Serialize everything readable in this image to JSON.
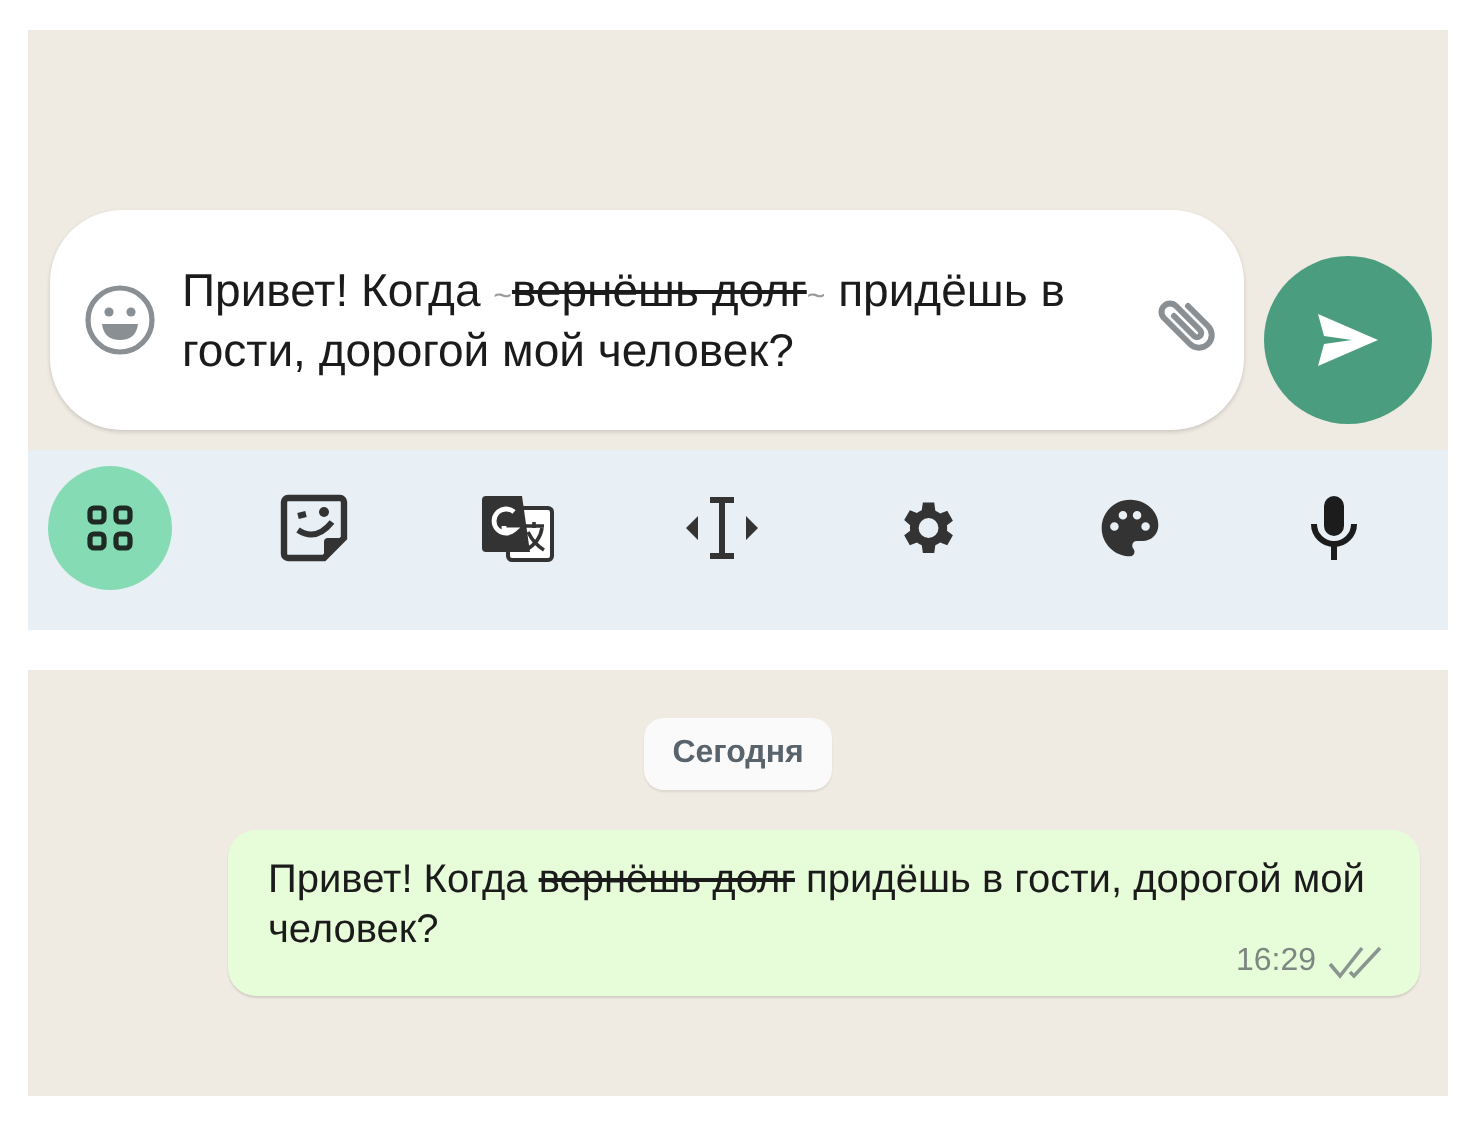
{
  "composer": {
    "segments": [
      {
        "kind": "text",
        "text": "Привет! Когда "
      },
      {
        "kind": "marker",
        "text": "~"
      },
      {
        "kind": "strike",
        "text": "вернёшь долг"
      },
      {
        "kind": "marker",
        "text": "~"
      },
      {
        "kind": "text",
        "text": " придёшь в гости, дорогой мой человек?"
      }
    ]
  },
  "toolbar": {
    "items": [
      {
        "selected": true
      },
      {
        "selected": false
      },
      {
        "selected": false
      },
      {
        "selected": false
      },
      {
        "selected": false
      },
      {
        "selected": false
      },
      {
        "selected": false
      }
    ]
  },
  "chat": {
    "date": "Сегодня",
    "message": {
      "segments": [
        {
          "kind": "text",
          "text": "Привет! Когда "
        },
        {
          "kind": "strike",
          "text": "вернёшь долг"
        },
        {
          "kind": "text",
          "text": " придёшь в гости, дорогой мой человек?"
        }
      ],
      "time": "16:29"
    }
  }
}
